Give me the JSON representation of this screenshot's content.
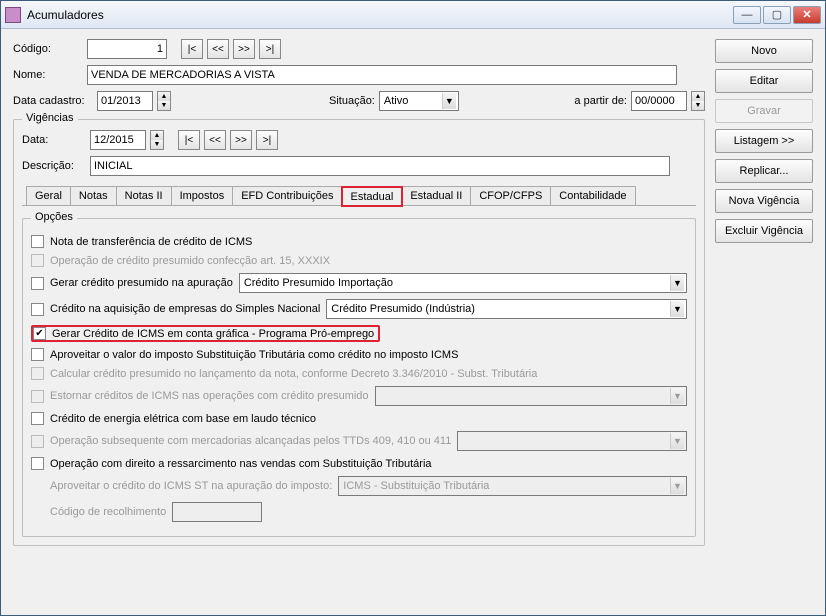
{
  "window": {
    "title": "Acumuladores"
  },
  "header": {
    "codigo_label": "Código:",
    "codigo_value": "1",
    "nome_label": "Nome:",
    "nome_value": "VENDA DE MERCADORIAS A VISTA",
    "datacad_label": "Data cadastro:",
    "datacad_value": "01/2013",
    "situacao_label": "Situação:",
    "situacao_value": "Ativo",
    "apartir_label": "a partir de:",
    "apartir_value": "00/0000"
  },
  "nav": {
    "first": "|<",
    "prev": "<<",
    "next": ">>",
    "last": ">|"
  },
  "vigencias": {
    "title": "Vigências",
    "data_label": "Data:",
    "data_value": "12/2015",
    "descricao_label": "Descrição:",
    "descricao_value": "INICIAL"
  },
  "tabs": {
    "geral": "Geral",
    "notas": "Notas",
    "notas2": "Notas II",
    "impostos": "Impostos",
    "efd": "EFD Contribuições",
    "estadual": "Estadual",
    "estadual2": "Estadual II",
    "cfop": "CFOP/CFPS",
    "contab": "Contabilidade"
  },
  "opcoes": {
    "title": "Opções",
    "nota_transferencia": "Nota de transferência de crédito de ICMS",
    "operacao_cred_presumido": "Operação de crédito presumido confecção art. 15, XXXIX",
    "gerar_cred_presumido": "Gerar crédito presumido na apuração",
    "gerar_cred_presumido_sel": "Crédito Presumido Importação",
    "credito_aquisicao": "Crédito na aquisição de empresas do Simples Nacional",
    "credito_aquisicao_sel": "Crédito Presumido (Indústria)",
    "gerar_credito_icms": "Gerar Crédito de ICMS em conta gráfica - Programa Pró-emprego",
    "aproveitar_valor": "Aproveitar o valor do imposto Substituição Tributária como crédito no imposto ICMS",
    "calcular_cred": "Calcular crédito presumido no lançamento da nota, conforme Decreto 3.346/2010 - Subst. Tributária",
    "estornar": "Estornar créditos de ICMS nas operações com crédito presumido",
    "credito_energia": "Crédito de energia elétrica com base em laudo técnico",
    "operacao_subseq": "Operação subsequente com mercadorias alcançadas pelos TTDs 409, 410 ou 411",
    "operacao_ressarc": "Operação com direito a ressarcimento nas vendas com Substituição Tributária",
    "aproveitar_credito_label": "Aproveitar o crédito do ICMS ST na apuração do imposto:",
    "aproveitar_credito_sel": "ICMS - Substituição Tributária",
    "codigo_recolh": "Código de recolhimento"
  },
  "side": {
    "novo": "Novo",
    "editar": "Editar",
    "gravar": "Gravar",
    "listagem": "Listagem >>",
    "replicar": "Replicar...",
    "nova_vig": "Nova Vigência",
    "excluir_vig": "Excluir Vigência"
  }
}
